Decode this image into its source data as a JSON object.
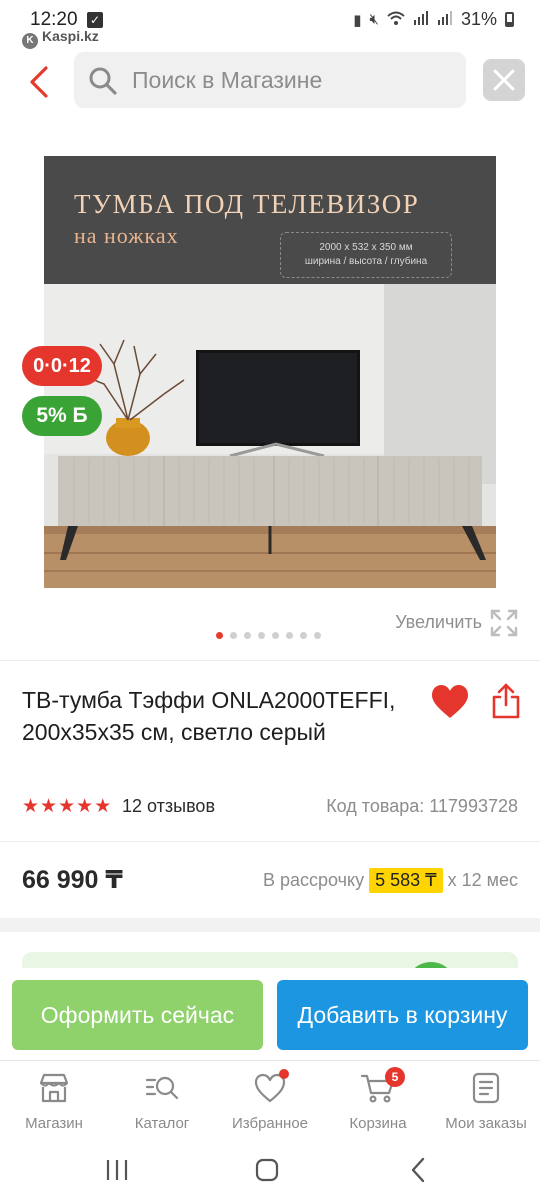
{
  "status_bar": {
    "time": "12:20",
    "app_label": "Kaspi.kz",
    "battery": "31%"
  },
  "search": {
    "placeholder": "Поиск в Магазине"
  },
  "product_image": {
    "banner_title": "ТУМБА ПОД ТЕЛЕВИЗОР",
    "banner_subtitle": "на ножках",
    "dimensions": "2000 x 532 x 350 мм",
    "dimensions_caption": "ширина / высота / глубина"
  },
  "badges": {
    "installment": "0·0·12",
    "bonus": "5% Б"
  },
  "gallery": {
    "zoom_label": "Увеличить",
    "slide_count": 8,
    "active_index": 0
  },
  "product": {
    "title": "ТВ-тумба Тэффи ONLA2000TEFFI, 200x35x35 см, светло серый",
    "rating": 5,
    "reviews": "12 отзывов",
    "code": "Код товара: 117993728",
    "price": "66 990 ₸",
    "installment_prefix": "В рассрочку",
    "installment_amount": "5 583 ₸",
    "installment_suffix": "x 12 мес"
  },
  "actions": {
    "checkout_label": "Оформить сейчас",
    "add_to_cart_label": "Добавить в корзину"
  },
  "tabbar": {
    "items": [
      {
        "label": "Магазин",
        "icon": "shop-icon"
      },
      {
        "label": "Каталог",
        "icon": "catalog-search-icon"
      },
      {
        "label": "Избранное",
        "icon": "heart-icon"
      },
      {
        "label": "Корзина",
        "icon": "cart-icon",
        "badge": "5"
      },
      {
        "label": "Мои заказы",
        "icon": "orders-icon"
      }
    ]
  },
  "colors": {
    "accent_red": "#e5362e",
    "checkout_green": "#8fd26b",
    "cart_blue": "#1c96e0",
    "installment_yellow": "#ffd400",
    "bonus_green": "#3aa335"
  }
}
